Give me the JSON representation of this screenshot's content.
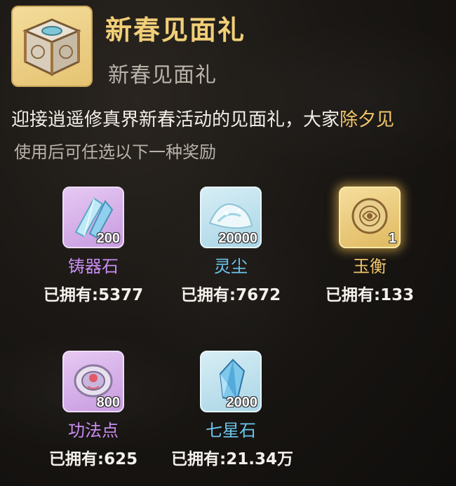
{
  "item": {
    "title": "新春见面礼",
    "subtitle": "新春见面礼",
    "icon": "gift-box-icon"
  },
  "description": {
    "text_main": "迎接逍遥修真界新春活动的见面礼，大家",
    "text_highlight": "除夕见",
    "hint": "使用后可任选以下一种奖励"
  },
  "colors": {
    "title": "#f1cf78",
    "highlight": "#f0c56a",
    "purple_name": "#c88cf0",
    "blue_name": "#6cc4ef",
    "gold_name": "#f0c56a"
  },
  "rewards": [
    {
      "name": "铸器石",
      "quantity": "200",
      "owned": "已拥有:5377",
      "icon": "crystal-shard-icon",
      "rarity": "purple"
    },
    {
      "name": "灵尘",
      "quantity": "20000",
      "owned": "已拥有:7672",
      "icon": "spirit-dust-icon",
      "rarity": "blue"
    },
    {
      "name": "玉衡",
      "quantity": "1",
      "owned": "已拥有:133",
      "icon": "jade-token-icon",
      "rarity": "gold"
    },
    {
      "name": "功法点",
      "quantity": "800",
      "owned": "已拥有:625",
      "icon": "skill-coin-icon",
      "rarity": "purple"
    },
    {
      "name": "七星石",
      "quantity": "2000",
      "owned": "已拥有:21.34万",
      "icon": "star-crystal-icon",
      "rarity": "blue"
    }
  ]
}
